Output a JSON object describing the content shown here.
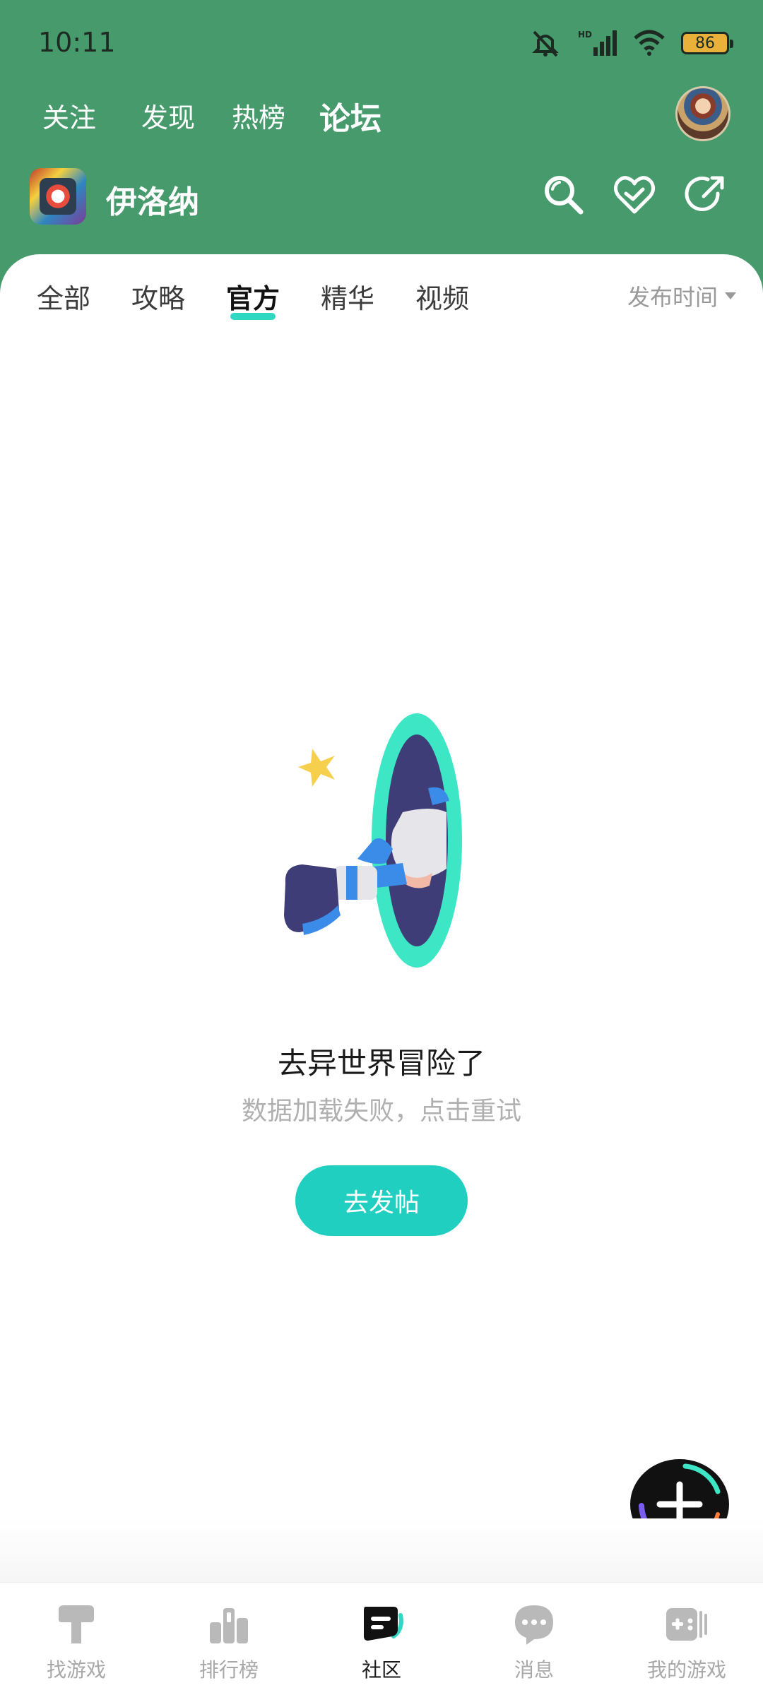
{
  "status": {
    "time": "10:11",
    "battery": "86",
    "network": "HD"
  },
  "top_tabs": [
    {
      "label": "关注"
    },
    {
      "label": "发现"
    },
    {
      "label": "热榜"
    },
    {
      "label": "论坛"
    }
  ],
  "game": {
    "name": "伊洛纳"
  },
  "sub_tabs": [
    {
      "label": "全部"
    },
    {
      "label": "攻略"
    },
    {
      "label": "官方"
    },
    {
      "label": "精华"
    },
    {
      "label": "视频"
    }
  ],
  "sort": {
    "label": "发布时间"
  },
  "empty_state": {
    "title": "去异世界冒险了",
    "subtitle": "数据加载失败，点击重试",
    "button": "去发帖"
  },
  "bottom_nav": [
    {
      "label": "找游戏",
      "icon": "find-game-icon"
    },
    {
      "label": "排行榜",
      "icon": "ranking-icon"
    },
    {
      "label": "社区",
      "icon": "community-icon"
    },
    {
      "label": "消息",
      "icon": "message-icon"
    },
    {
      "label": "我的游戏",
      "icon": "my-games-icon"
    }
  ],
  "colors": {
    "header_bg": "#469a6c",
    "accent": "#20cfbf",
    "tab_underline": "#37dcc6"
  }
}
